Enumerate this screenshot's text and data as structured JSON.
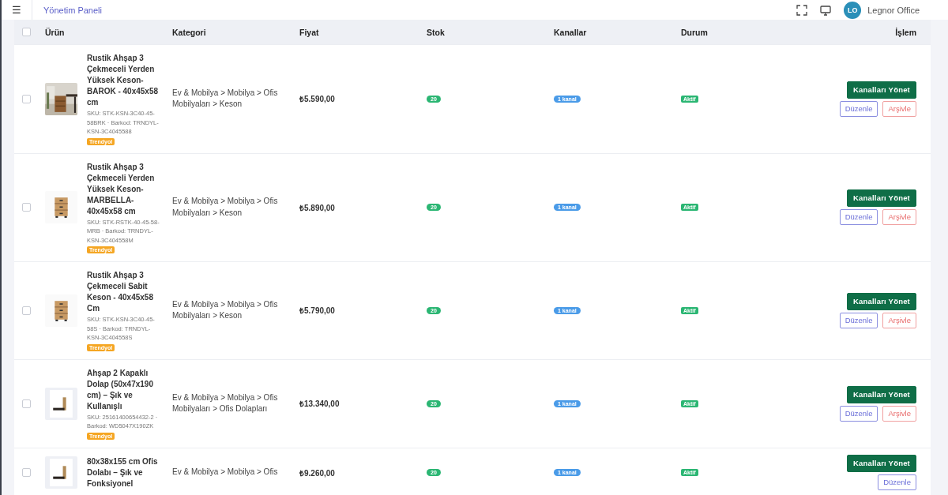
{
  "header": {
    "menu_icon": "☰",
    "title": "Yönetim Paneli",
    "user": {
      "initials": "LO",
      "name": "Legnor Office"
    }
  },
  "table": {
    "select_all_checked": false,
    "columns": [
      "Ürün",
      "Kategori",
      "Fiyat",
      "Stok",
      "Kanallar",
      "Durum",
      "İşlem"
    ],
    "rows": [
      {
        "checked": false,
        "title": "Rustik Ahşap 3 Çekmeceli Yerden Yüksek Keson- BAROK - 40x45x58 cm",
        "meta": "SKU: STK-KSN-3C40-45-58BRK · Barkod: TRNDYL-KSN-3C4045588",
        "tag": "Trendyol",
        "category": "Ev & Mobilya > Mobilya > Ofis Mobilyaları > Keson",
        "price": "₺5.590,00",
        "stock": "20",
        "channels": "1 kanal",
        "status": "Aktif",
        "actions": [
          "Kanalları Yönet",
          "Düzenle",
          "Arşivle"
        ]
      },
      {
        "checked": false,
        "title": "Rustik Ahşap 3 Çekmeceli Yerden Yüksek Keson- MARBELLA- 40x45x58 cm",
        "meta": "SKU: STK-RSTK-40-45-58-MRB · Barkod: TRNDYL-KSN-3C404558M",
        "tag": "Trendyol",
        "category": "Ev & Mobilya > Mobilya > Ofis Mobilyaları > Keson",
        "price": "₺5.890,00",
        "stock": "20",
        "channels": "1 kanal",
        "status": "Aktif",
        "actions": [
          "Kanalları Yönet",
          "Düzenle",
          "Arşivle"
        ]
      },
      {
        "checked": false,
        "title": "Rustik Ahşap 3 Çekmeceli Sabit Keson - 40x45x58 Cm",
        "meta": "SKU: STK-KSN-3C40-45-58S · Barkod: TRNDYL-KSN-3C404558S",
        "tag": "Trendyol",
        "category": "Ev & Mobilya > Mobilya > Ofis Mobilyaları > Keson",
        "price": "₺5.790,00",
        "stock": "20",
        "channels": "1 kanal",
        "status": "Aktif",
        "actions": [
          "Kanalları Yönet",
          "Düzenle",
          "Arşivle"
        ]
      },
      {
        "checked": false,
        "title": "Ahşap 2 Kapaklı Dolap (50x47x190 cm) – Şık ve Kullanışlı",
        "meta": "SKU: 25161400654432-2 · Barkod: WD5047X190ZK",
        "tag": "Trendyol",
        "category": "Ev & Mobilya > Mobilya > Ofis Mobilyaları > Ofis Dolapları",
        "price": "₺13.340,00",
        "stock": "20",
        "channels": "1 kanal",
        "status": "Aktif",
        "actions": [
          "Kanalları Yönet",
          "Düzenle",
          "Arşivle"
        ]
      },
      {
        "checked": false,
        "title": "80x38x155 cm Ofis Dolabı – Şık ve Fonksiyonel",
        "category": "Ev & Mobilya > Mobilya > Ofis",
        "price": "₺9.260,00",
        "stock": "20",
        "channels": "1 kanal",
        "status": "Aktif",
        "actions": [
          "Kanalları Yönet",
          "Düzenle"
        ]
      }
    ]
  }
}
